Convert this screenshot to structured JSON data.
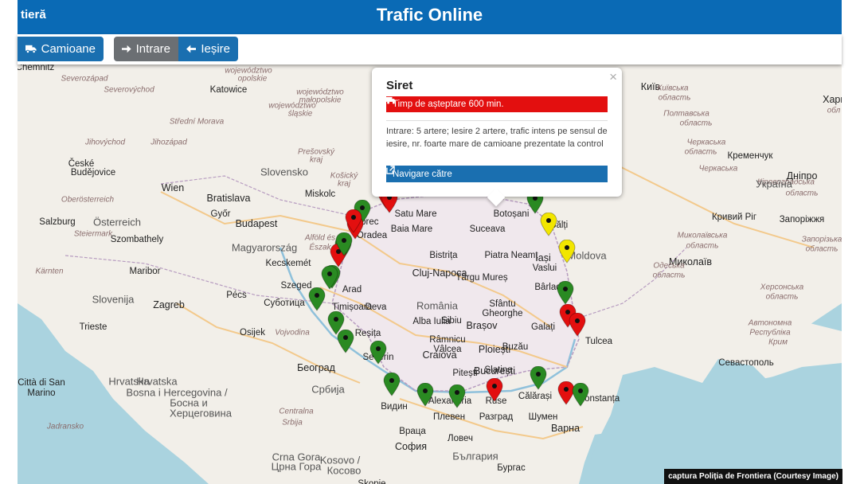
{
  "header": {
    "brand": "tieră",
    "title": "Trafic Online"
  },
  "toolbar": {
    "camioane_label": "Camioane",
    "intrare_label": "Intrare",
    "iesire_label": "Ieșire"
  },
  "popup": {
    "title": "Siret",
    "status": "Timp de așteptare 600 min.",
    "description": "Intrare: 5 artere; Iesire 2 artere, trafic intens pe sensul de iesire, nr. foarte mare de camioane prezentate la control",
    "nav_label": "Navigare către",
    "close": "×"
  },
  "caption": "captura Poliția de Frontiera (Courtesy Image)",
  "colors": {
    "red": "#e30f0f",
    "green": "#2a8a22",
    "yellow": "#f2e600",
    "blue": "#1a6fb0"
  },
  "icons": [
    "truck-icon",
    "arrow-right-icon",
    "arrow-left-icon",
    "close-icon",
    "external-link-icon",
    "map-marker-icon"
  ],
  "map": {
    "labels": [
      {
        "t": "Chemnitz",
        "c": "city"
      },
      {
        "t": "Severozápad",
        "c": "region"
      },
      {
        "t": "Severovýchod",
        "c": "region"
      },
      {
        "t": "Katowice",
        "c": "city"
      },
      {
        "t": "województwo",
        "c": "region"
      },
      {
        "t": "opolskie",
        "c": "region"
      },
      {
        "t": "województwo",
        "c": "region"
      },
      {
        "t": "śląskie",
        "c": "region"
      },
      {
        "t": "województwo",
        "c": "region"
      },
      {
        "t": "małopolskie",
        "c": "region"
      },
      {
        "t": "Střední Morava",
        "c": "region"
      },
      {
        "t": "Jihovýchod",
        "c": "region"
      },
      {
        "t": "Jihozápad",
        "c": "region"
      },
      {
        "t": "Prešovský",
        "c": "region"
      },
      {
        "t": "kraj",
        "c": "region"
      },
      {
        "t": "Košický",
        "c": "region"
      },
      {
        "t": "kraj",
        "c": "region"
      },
      {
        "t": "České",
        "c": "city"
      },
      {
        "t": "Budějovice",
        "c": "city"
      },
      {
        "t": "Slovensko",
        "c": "country"
      },
      {
        "t": "Wien",
        "c": "city bold"
      },
      {
        "t": "Bratislava",
        "c": "city bold"
      },
      {
        "t": "Oberösterreich",
        "c": "region"
      },
      {
        "t": "Miskolc",
        "c": "city"
      },
      {
        "t": "Österreich",
        "c": "country"
      },
      {
        "t": "Győr",
        "c": "city"
      },
      {
        "t": "Salzburg",
        "c": "city"
      },
      {
        "t": "Budapest",
        "c": "city bold"
      },
      {
        "t": "Steiermark",
        "c": "region"
      },
      {
        "t": "Szombathely",
        "c": "city"
      },
      {
        "t": "Magyarország",
        "c": "country"
      },
      {
        "t": "Alföld és",
        "c": "region"
      },
      {
        "t": "Észak",
        "c": "region"
      },
      {
        "t": "Kärnten",
        "c": "region"
      },
      {
        "t": "Kecskemét",
        "c": "city"
      },
      {
        "t": "Maribor",
        "c": "city"
      },
      {
        "t": "Szeged",
        "c": "city"
      },
      {
        "t": "Slovenija",
        "c": "country"
      },
      {
        "t": "Zagreb",
        "c": "city bold"
      },
      {
        "t": "Pécs",
        "c": "city"
      },
      {
        "t": "Суботица",
        "c": "city"
      },
      {
        "t": "Trieste",
        "c": "city"
      },
      {
        "t": "Hrvatska",
        "c": "country"
      },
      {
        "t": "Osijek",
        "c": "city"
      },
      {
        "t": "Vojvodina",
        "c": "region"
      },
      {
        "t": "Београд",
        "c": "city bold"
      },
      {
        "t": "Città di San",
        "c": "city"
      },
      {
        "t": "Marino",
        "c": "city"
      },
      {
        "t": "Hrvatska",
        "c": "country"
      },
      {
        "t": "Bosna i Hercegovina /",
        "c": "country"
      },
      {
        "t": "Босна и",
        "c": "country"
      },
      {
        "t": "Херцеговина",
        "c": "country"
      },
      {
        "t": "Србија",
        "c": "country"
      },
      {
        "t": "Jadransko",
        "c": "region"
      },
      {
        "t": "Centralna",
        "c": "region"
      },
      {
        "t": "Srbija",
        "c": "region"
      },
      {
        "t": "Crna Gora",
        "c": "country"
      },
      {
        "t": "Kosovo /",
        "c": "country"
      },
      {
        "t": "Црна Гора",
        "c": "country"
      },
      {
        "t": "Косово",
        "c": "country"
      },
      {
        "t": "Skopje",
        "c": "city"
      },
      {
        "t": "Satu Mare",
        "c": "city"
      },
      {
        "t": "Debrec",
        "c": "city"
      },
      {
        "t": "Oradea",
        "c": "city"
      },
      {
        "t": "Baia Mare",
        "c": "city"
      },
      {
        "t": "Suceava",
        "c": "city"
      },
      {
        "t": "Botoșani",
        "c": "city"
      },
      {
        "t": "Bălți",
        "c": "city"
      },
      {
        "t": "Bistrița",
        "c": "city"
      },
      {
        "t": "Piatra Neamț",
        "c": "city"
      },
      {
        "t": "Iași",
        "c": "city bold"
      },
      {
        "t": "Moldova",
        "c": "country"
      },
      {
        "t": "Cluj-Napoca",
        "c": "city bold"
      },
      {
        "t": "Târgu Mureș",
        "c": "city"
      },
      {
        "t": "Vaslui",
        "c": "city"
      },
      {
        "t": "Arad",
        "c": "city"
      },
      {
        "t": "România",
        "c": "country"
      },
      {
        "t": "Sibiu",
        "c": "city"
      },
      {
        "t": "Sfântu",
        "c": "city"
      },
      {
        "t": "Gheorghe",
        "c": "city"
      },
      {
        "t": "Bârlad",
        "c": "city"
      },
      {
        "t": "Timișoara",
        "c": "city"
      },
      {
        "t": "Deva",
        "c": "city"
      },
      {
        "t": "Alba Iulia",
        "c": "city"
      },
      {
        "t": "Reșița",
        "c": "city"
      },
      {
        "t": "Brașov",
        "c": "city bold"
      },
      {
        "t": "Galați",
        "c": "city"
      },
      {
        "t": "Râmnicu",
        "c": "city"
      },
      {
        "t": "Vâlcea",
        "c": "city"
      },
      {
        "t": "Buzău",
        "c": "city"
      },
      {
        "t": "Tulcea",
        "c": "city"
      },
      {
        "t": "Severin",
        "c": "city"
      },
      {
        "t": "Ploiești",
        "c": "city bold"
      },
      {
        "t": "Craiova",
        "c": "city bold"
      },
      {
        "t": "Pitești",
        "c": "city"
      },
      {
        "t": "Slatina",
        "c": "city"
      },
      {
        "t": "București",
        "c": "city bold"
      },
      {
        "t": "Constanța",
        "c": "city"
      },
      {
        "t": "Călărași",
        "c": "city"
      },
      {
        "t": "Видин",
        "c": "city"
      },
      {
        "t": "Alexandria",
        "c": "city"
      },
      {
        "t": "Ruse",
        "c": "city"
      },
      {
        "t": "Плевен",
        "c": "city"
      },
      {
        "t": "Разград",
        "c": "city"
      },
      {
        "t": "Шумен",
        "c": "city"
      },
      {
        "t": "Варна",
        "c": "city bold"
      },
      {
        "t": "Враца",
        "c": "city"
      },
      {
        "t": "Ловеч",
        "c": "city"
      },
      {
        "t": "София",
        "c": "city bold"
      },
      {
        "t": "България",
        "c": "country"
      },
      {
        "t": "Бургас",
        "c": "city"
      },
      {
        "t": "Київ",
        "c": "city bold"
      },
      {
        "t": "Київська",
        "c": "region"
      },
      {
        "t": "область",
        "c": "region"
      },
      {
        "t": "Полтавська",
        "c": "region"
      },
      {
        "t": "область",
        "c": "region"
      },
      {
        "t": "Черкаська",
        "c": "region"
      },
      {
        "t": "область",
        "c": "region"
      },
      {
        "t": "Кременчук",
        "c": "city"
      },
      {
        "t": "Дніпро",
        "c": "city bold"
      },
      {
        "t": "Кіровоградська",
        "c": "region"
      },
      {
        "t": "область",
        "c": "region"
      },
      {
        "t": "Україна",
        "c": "country"
      },
      {
        "t": "Кривий Ріг",
        "c": "city"
      },
      {
        "t": "Запоріжжя",
        "c": "city"
      },
      {
        "t": "Миколаївська",
        "c": "region"
      },
      {
        "t": "область",
        "c": "region"
      },
      {
        "t": "Миколаїв",
        "c": "city bold"
      },
      {
        "t": "Одеська",
        "c": "region"
      },
      {
        "t": "область",
        "c": "region"
      },
      {
        "t": "Запорізька",
        "c": "region"
      },
      {
        "t": "область",
        "c": "region"
      },
      {
        "t": "Херсонська",
        "c": "region"
      },
      {
        "t": "область",
        "c": "region"
      },
      {
        "t": "Автономна",
        "c": "region"
      },
      {
        "t": "Республіка",
        "c": "region"
      },
      {
        "t": "Крим",
        "c": "region"
      },
      {
        "t": "Севастополь",
        "c": "city"
      },
      {
        "t": "Харк",
        "c": "city bold"
      },
      {
        "t": "обл",
        "c": "region"
      },
      {
        "t": "Черкаська",
        "c": "region"
      }
    ],
    "markers": [
      {
        "s": "red"
      },
      {
        "s": "green"
      },
      {
        "s": "red"
      },
      {
        "s": "red"
      },
      {
        "s": "green"
      },
      {
        "s": "red"
      },
      {
        "s": "red"
      },
      {
        "s": "green"
      },
      {
        "s": "green"
      },
      {
        "s": "green"
      },
      {
        "s": "green"
      },
      {
        "s": "green"
      },
      {
        "s": "green"
      },
      {
        "s": "green"
      },
      {
        "s": "green"
      },
      {
        "s": "green"
      },
      {
        "s": "red"
      },
      {
        "s": "green"
      },
      {
        "s": "red"
      },
      {
        "s": "green"
      },
      {
        "s": "green"
      },
      {
        "s": "yellow"
      },
      {
        "s": "yellow"
      },
      {
        "s": "green"
      },
      {
        "s": "red"
      },
      {
        "s": "red"
      },
      {
        "s": "green"
      }
    ]
  }
}
